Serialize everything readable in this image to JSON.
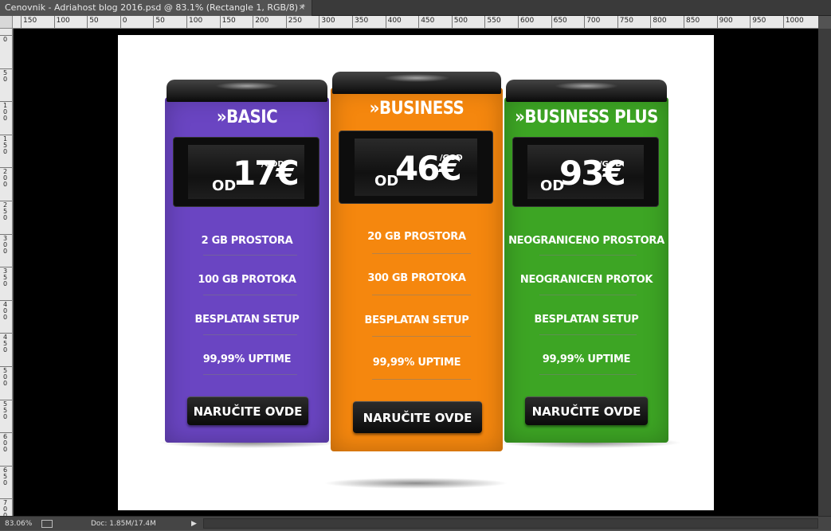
{
  "window": {
    "tab_title": "Cenovnik - Adriahost blog 2016.psd @ 83.1% (Rectangle 1, RGB/8) *",
    "close_glyph": "×"
  },
  "rulers": {
    "horizontal": [
      "150",
      "100",
      "50",
      "0",
      "50",
      "100",
      "150",
      "200",
      "250",
      "300",
      "350",
      "400",
      "450",
      "500",
      "550",
      "600",
      "650",
      "700",
      "750",
      "800",
      "850",
      "900",
      "950",
      "1000"
    ],
    "vertical": [
      "0",
      "50",
      "100",
      "150",
      "200",
      "250",
      "300",
      "350",
      "400",
      "450",
      "500",
      "550",
      "600",
      "650",
      "700"
    ]
  },
  "status": {
    "zoom": "83.06%",
    "doc": "Doc: 1.85M/17.4M",
    "arrow": "▶"
  },
  "plans": [
    {
      "name": "»BASIC",
      "od": "OD",
      "price": "17€",
      "period": "/GOD",
      "features": [
        "2 GB PROSTORA",
        "100 GB PROTOKA",
        "BESPLATAN SETUP",
        "99,99% UPTIME"
      ],
      "button": "NARUČITE OVDE",
      "color": "#6a45c2"
    },
    {
      "name": "»BUSINESS",
      "od": "OD",
      "price": "46€",
      "period": "/GOD",
      "features": [
        "20 GB PROSTORA",
        "300 GB PROTOKA",
        "BESPLATAN SETUP",
        "99,99% UPTIME"
      ],
      "button": "NARUČITE OVDE",
      "color": "#f5870e"
    },
    {
      "name": "»BUSINESS PLUS",
      "od": "OD",
      "price": "93€",
      "period": "/GOD",
      "features": [
        "NEOGRANICENO PROSTORA",
        "NEOGRANICEN PROTOK",
        "BESPLATAN SETUP",
        "99,99% UPTIME"
      ],
      "button": "NARUČITE OVDE",
      "color": "#3da524"
    }
  ]
}
